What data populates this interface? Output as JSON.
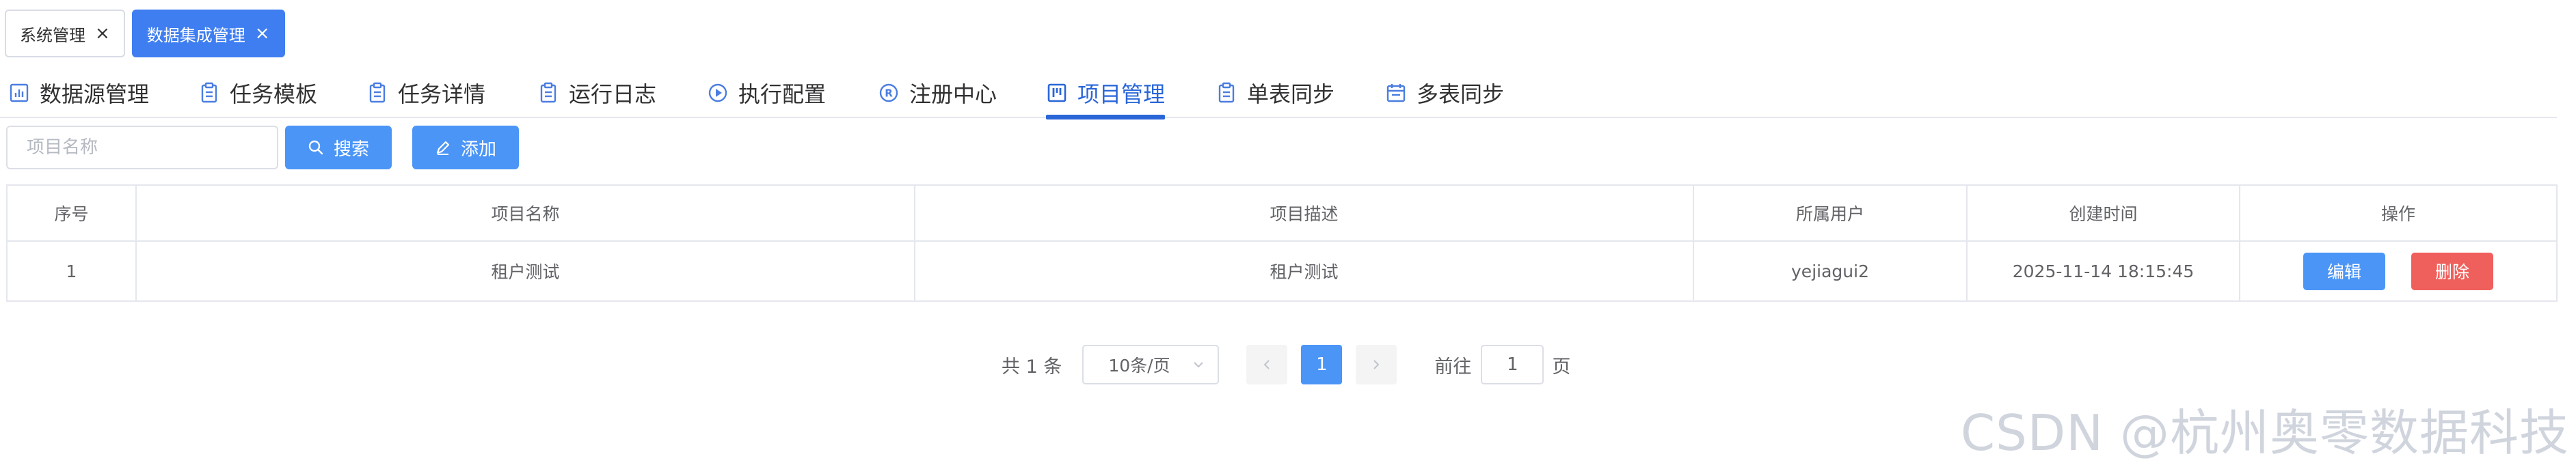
{
  "page_tags": [
    {
      "label": "系统管理",
      "active": false
    },
    {
      "label": "数据集成管理",
      "active": true
    }
  ],
  "tabs": [
    {
      "label": "数据源管理",
      "icon": "bar-chart-icon"
    },
    {
      "label": "任务模板",
      "icon": "clipboard-icon"
    },
    {
      "label": "任务详情",
      "icon": "clipboard-icon"
    },
    {
      "label": "运行日志",
      "icon": "clipboard-icon"
    },
    {
      "label": "执行配置",
      "icon": "play-circle-icon"
    },
    {
      "label": "注册中心",
      "icon": "registered-icon"
    },
    {
      "label": "项目管理",
      "icon": "kanban-icon",
      "active": true
    },
    {
      "label": "单表同步",
      "icon": "clipboard-icon"
    },
    {
      "label": "多表同步",
      "icon": "calendar-icon"
    }
  ],
  "toolbar": {
    "search_placeholder": "项目名称",
    "search_label": "搜索",
    "add_label": "添加"
  },
  "table": {
    "columns": [
      "序号",
      "项目名称",
      "项目描述",
      "所属用户",
      "创建时间",
      "操作"
    ],
    "rows": [
      {
        "index": "1",
        "name": "租户测试",
        "description": "租户测试",
        "owner": "yejiagui2",
        "created": "2025-11-14 18:15:45"
      }
    ],
    "edit_label": "编辑",
    "delete_label": "删除"
  },
  "pagination": {
    "total_text": "共 1 条",
    "page_size": "10条/页",
    "current_page": "1",
    "goto_label": "前往",
    "goto_value": "1",
    "goto_suffix": "页"
  },
  "watermark": "CSDN @杭州奥零数据科技",
  "colors": {
    "primary": "#4b95f7",
    "tab_active": "#2a66d8",
    "danger": "#ef5f5b",
    "tag_active": "#3f7ef0"
  }
}
